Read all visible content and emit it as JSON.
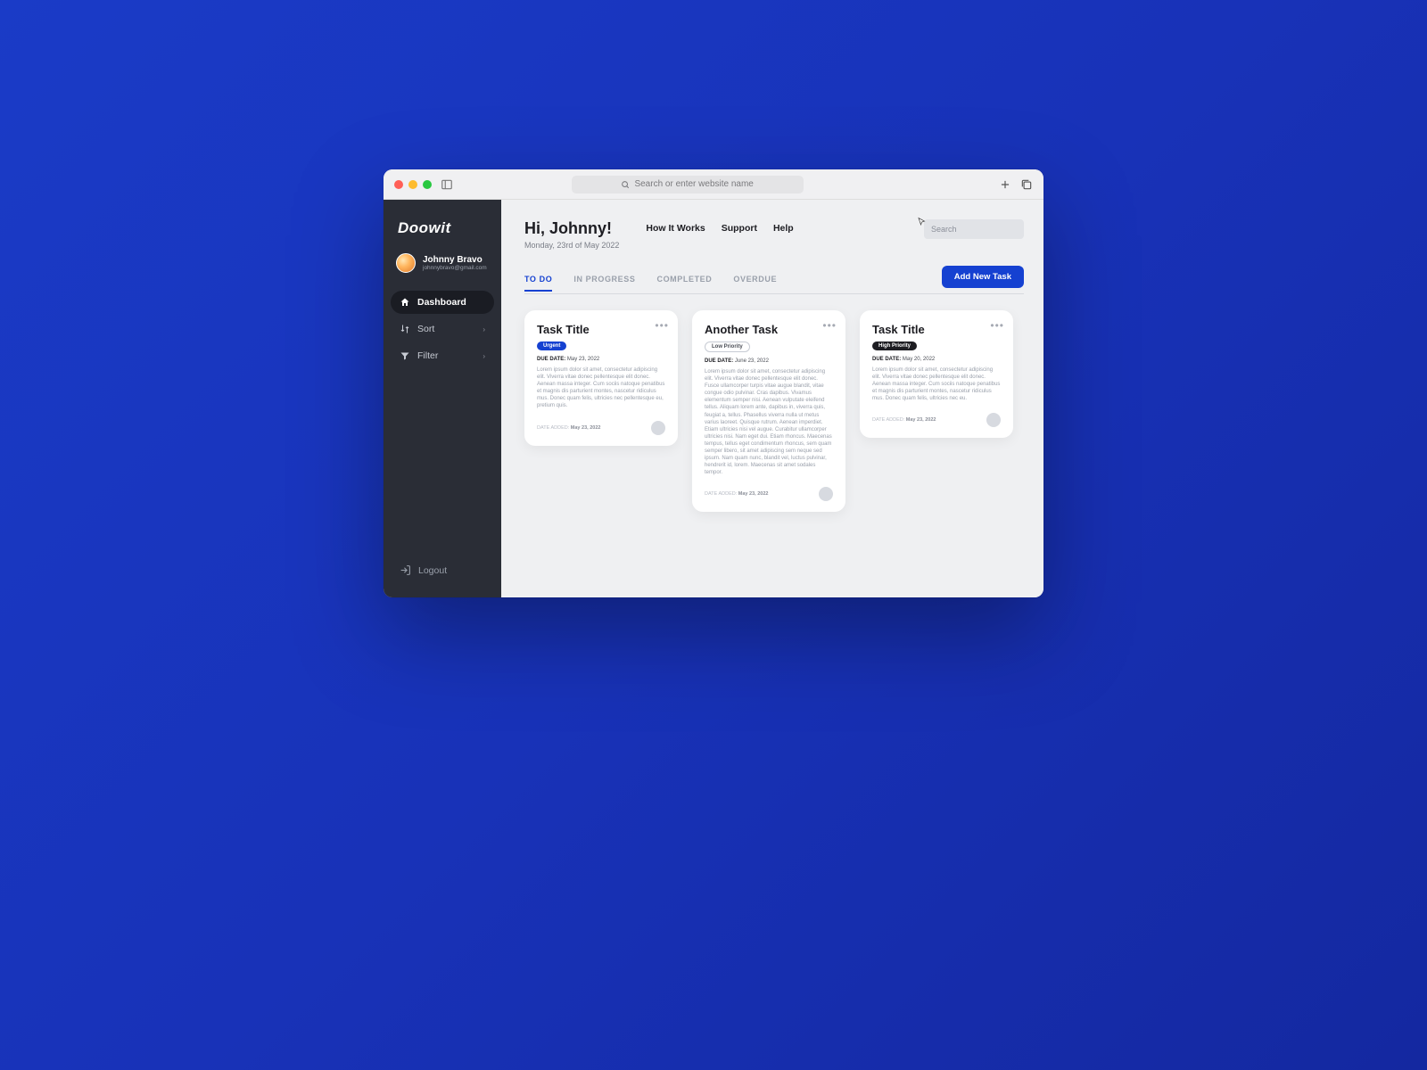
{
  "chrome": {
    "address_placeholder": "Search or enter website name"
  },
  "brand": "Doowit",
  "user": {
    "name": "Johnny Bravo",
    "email": "johnnybravo@gmail.com"
  },
  "sidebar": {
    "items": [
      {
        "label": "Dashboard",
        "active": true
      },
      {
        "label": "Sort"
      },
      {
        "label": "Filter"
      }
    ],
    "logout": "Logout"
  },
  "header": {
    "greeting": "Hi, Johnny!",
    "date": "Monday, 23rd of May 2022",
    "links": [
      "How It Works",
      "Support",
      "Help"
    ],
    "search_placeholder": "Search"
  },
  "tabs": [
    "TO DO",
    "IN PROGRESS",
    "COMPLETED",
    "OVERDUE"
  ],
  "primary_action": "Add New Task",
  "cards": [
    {
      "title": "Task Title",
      "badge": "Urgent",
      "badge_style": "urgent",
      "due_label": "DUE DATE:",
      "due_value": "May 23, 2022",
      "desc": "Lorem ipsum dolor sit amet, consectetur adipiscing elit. Viverra vitae donec pellentesque elit donec. Aenean massa integer. Cum sociis natoque penatibus et magnis dis parturient montes, nascetur ridiculus mus. Donec quam felis, ultricies nec pellentesque eu, pretium quis.",
      "added_label": "DATE ADDED:",
      "added_value": "May 23, 2022"
    },
    {
      "title": "Another Task",
      "badge": "Low Priority",
      "badge_style": "low",
      "due_label": "DUE DATE:",
      "due_value": "June 23, 2022",
      "desc": "Lorem ipsum dolor sit amet, consectetur adipiscing elit. Viverra vitae donec pellentesque elit donec. Fusce ullamcorper turpis vitae augue blandit, vitae congue odio pulvinar. Cras dapibus. Vivamus elementum semper nisi. Aenean vulputate eleifend tellus. Aliquam lorem ante, dapibus in, viverra quis, feugiat a, tellus. Phasellus viverra nulla ut metus varius laoreet. Quisque rutrum. Aenean imperdiet. Etiam ultricies nisi vel augue. Curabitur ullamcorper ultricies nisi. Nam eget dui. Etiam rhoncus. Maecenas tempus, tellus eget condimentum rhoncus, sem quam semper libero, sit amet adipiscing sem neque sed ipsum. Nam quam nunc, blandit vel, luctus pulvinar, hendrerit id, lorem. Maecenas sit amet sodales tempor.",
      "added_label": "DATE ADDED:",
      "added_value": "May 23, 2022"
    },
    {
      "title": "Task Title",
      "badge": "High Priority",
      "badge_style": "high",
      "due_label": "DUE DATE:",
      "due_value": "May 20, 2022",
      "desc": "Lorem ipsum dolor sit amet, consectetur adipiscing elit. Viverra vitae donec pellentesque elit donec. Aenean massa integer. Cum sociis natoque penatibus et magnis dis parturient montes, nascetur ridiculus mus. Donec quam felis, ultricies nec eu.",
      "added_label": "DATE ADDED:",
      "added_value": "May 23, 2022"
    }
  ]
}
